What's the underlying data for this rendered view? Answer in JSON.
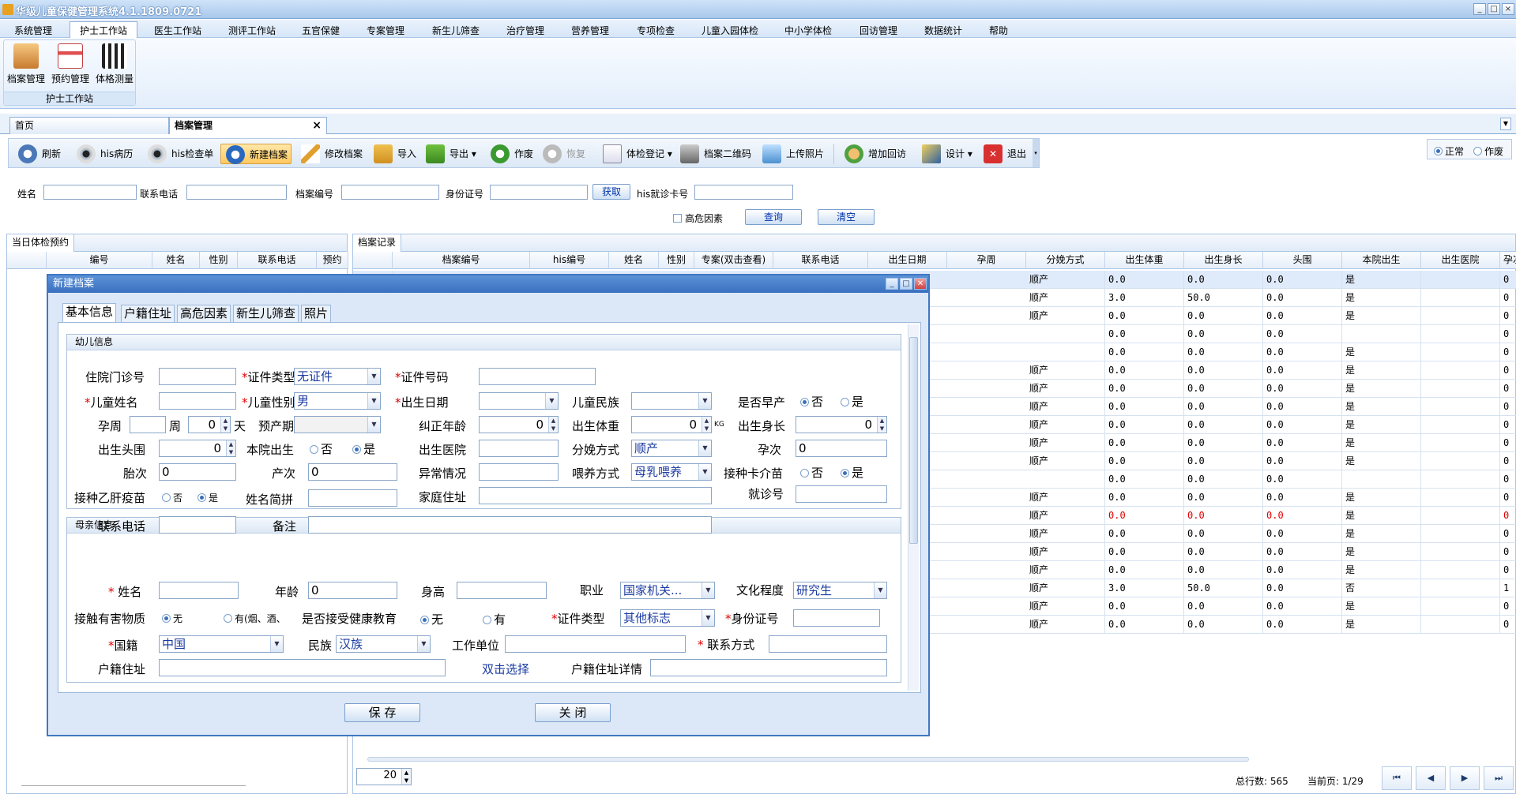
{
  "app": {
    "title": "华级儿童保健管理系统4.1.1809.0721"
  },
  "menu": [
    "系统管理",
    "护士工作站",
    "医生工作站",
    "测评工作站",
    "五官保健",
    "专案管理",
    "新生儿筛查",
    "治疗管理",
    "营养管理",
    "专项检查",
    "儿童入园体检",
    "中小学体检",
    "回访管理",
    "数据统计",
    "帮助"
  ],
  "ribbon": {
    "group_label": "护士工作站",
    "buttons": [
      "档案管理",
      "预约管理",
      "体格测量"
    ]
  },
  "page_tabs": {
    "home": "首页",
    "active": "档案管理",
    "close": "×"
  },
  "toolbar": {
    "items": [
      "刷新",
      "his病历",
      "his检查单",
      "新建档案",
      "修改档案",
      "导入",
      "导出",
      "作废",
      "恢复",
      "体检登记",
      "档案二维码",
      "上传照片",
      "增加回访",
      "设计",
      "退出"
    ],
    "status_normal": "正常",
    "status_void": "作废"
  },
  "search": {
    "name_label": "姓名",
    "phone_label": "联系电话",
    "file_no_label": "档案编号",
    "id_label": "身份证号",
    "fetch_button": "获取",
    "his_card_label": "his就诊卡号",
    "high_risk_label": "高危因素",
    "query_button": "查询",
    "clear_button": "清空"
  },
  "left_panel": {
    "title": "当日体检预约",
    "columns": [
      "编号",
      "姓名",
      "性别",
      "联系电话",
      "预约"
    ]
  },
  "right_panel": {
    "title": "档案记录",
    "columns": [
      "档案编号",
      "his编号",
      "姓名",
      "性别",
      "专案(双击查看)",
      "联系电话",
      "出生日期",
      "孕周",
      "分娩方式",
      "出生体重",
      "出生身长",
      "头围",
      "本院出生",
      "出生医院",
      "孕次"
    ],
    "rows": [
      {
        "delivery": "顺产",
        "w": "0.0",
        "l": "0.0",
        "h": "0.0",
        "local": "是",
        "g": "0"
      },
      {
        "delivery": "顺产",
        "w": "3.0",
        "l": "50.0",
        "h": "0.0",
        "local": "是",
        "g": "0"
      },
      {
        "delivery": "顺产",
        "w": "0.0",
        "l": "0.0",
        "h": "0.0",
        "local": "是",
        "g": "0"
      },
      {
        "delivery": "",
        "w": "0.0",
        "l": "0.0",
        "h": "0.0",
        "local": "",
        "g": "0"
      },
      {
        "delivery": "",
        "w": "0.0",
        "l": "0.0",
        "h": "0.0",
        "local": "是",
        "g": "0"
      },
      {
        "delivery": "顺产",
        "w": "0.0",
        "l": "0.0",
        "h": "0.0",
        "local": "是",
        "g": "0"
      },
      {
        "delivery": "顺产",
        "w": "0.0",
        "l": "0.0",
        "h": "0.0",
        "local": "是",
        "g": "0"
      },
      {
        "delivery": "顺产",
        "w": "0.0",
        "l": "0.0",
        "h": "0.0",
        "local": "是",
        "g": "0"
      },
      {
        "delivery": "顺产",
        "w": "0.0",
        "l": "0.0",
        "h": "0.0",
        "local": "是",
        "g": "0"
      },
      {
        "delivery": "顺产",
        "w": "0.0",
        "l": "0.0",
        "h": "0.0",
        "local": "是",
        "g": "0"
      },
      {
        "delivery": "顺产",
        "w": "0.0",
        "l": "0.0",
        "h": "0.0",
        "local": "是",
        "g": "0"
      },
      {
        "delivery": "",
        "w": "0.0",
        "l": "0.0",
        "h": "0.0",
        "local": "",
        "g": "0"
      },
      {
        "delivery": "顺产",
        "w": "0.0",
        "l": "0.0",
        "h": "0.0",
        "local": "是",
        "g": "0"
      },
      {
        "delivery": "顺产",
        "w": "0.0",
        "l": "0.0",
        "h": "0.0",
        "local": "是",
        "g": "0",
        "red": true
      },
      {
        "delivery": "顺产",
        "w": "0.0",
        "l": "0.0",
        "h": "0.0",
        "local": "是",
        "g": "0"
      },
      {
        "delivery": "顺产",
        "w": "0.0",
        "l": "0.0",
        "h": "0.0",
        "local": "是",
        "g": "0"
      },
      {
        "delivery": "顺产",
        "w": "0.0",
        "l": "0.0",
        "h": "0.0",
        "local": "是",
        "g": "0"
      },
      {
        "delivery": "顺产",
        "w": "3.0",
        "l": "50.0",
        "h": "0.0",
        "local": "否",
        "g": "1"
      },
      {
        "delivery": "顺产",
        "w": "0.0",
        "l": "0.0",
        "h": "0.0",
        "local": "是",
        "g": "0"
      },
      {
        "delivery": "顺产",
        "w": "0.0",
        "l": "0.0",
        "h": "0.0",
        "local": "是",
        "g": "0"
      }
    ],
    "page_size": "20",
    "total_label": "总行数: 565",
    "page_label": "当前页: 1/29",
    "nav": [
      "⏮",
      "◀",
      "▶",
      "⏭"
    ]
  },
  "dialog": {
    "title": "新建档案",
    "tabs": [
      "基本信息",
      "户籍住址",
      "高危因素",
      "新生儿筛查",
      "照片"
    ],
    "child_section": "幼儿信息",
    "mother_section": "母亲信息",
    "req": "*",
    "labels": {
      "inpatient_no": "住院门诊号",
      "id_type": "证件类型",
      "id_no": "证件号码",
      "child_name": "儿童姓名",
      "child_sex": "儿童性别",
      "birth_date": "出生日期",
      "child_nation": "儿童民族",
      "premature": "是否早产",
      "gest_week": "孕周",
      "week": "周",
      "day": "天",
      "due_date": "预产期",
      "corrected_age": "纠正年龄",
      "birth_weight": "出生体重",
      "birth_length": "出生身长",
      "head_circ": "出生头围",
      "born_here": "本院出生",
      "birth_hospital": "出生医院",
      "delivery": "分娩方式",
      "gravida": "孕次",
      "parity": "胎次",
      "para": "产次",
      "abnormal": "异常情况",
      "feeding": "喂养方式",
      "vaccine_card": "接种卡介苗",
      "hepb": "接种乙肝疫苗",
      "name_abbr": "姓名简拼",
      "home_addr": "家庭住址",
      "visit_no": "就诊号",
      "phone": "联系电话",
      "remark": "备注",
      "m_name": "姓名",
      "m_age": "年龄",
      "m_height": "身高",
      "m_job": "职业",
      "m_edu": "文化程度",
      "m_hazard": "接触有害物质",
      "m_health_edu": "是否接受健康教育",
      "m_id_type": "证件类型",
      "m_id_no": "身份证号",
      "m_nationality": "国籍",
      "m_nation": "民族",
      "m_work": "工作单位",
      "m_contact": "联系方式",
      "m_hukou": "户籍住址",
      "m_hukou_pick": "双击选择",
      "m_hukou_detail": "户籍住址详情"
    },
    "values": {
      "id_type": "无证件",
      "child_sex": "男",
      "gest_day": "0",
      "corrected_age": "0",
      "birth_weight": "0",
      "kg": "KG",
      "birth_length": "0",
      "head_circ": "0",
      "delivery": "顺产",
      "gravida": "0",
      "parity": "0",
      "para": "0",
      "feeding": "母乳喂养",
      "m_age": "0",
      "m_job": "国家机关...",
      "m_edu": "研究生",
      "m_id_type": "其他标志",
      "m_nationality": "中国",
      "m_nation": "汉族"
    },
    "options": {
      "no": "否",
      "yes": "是",
      "hazard_no": "无",
      "hazard_yes": "有(烟、酒、",
      "edu_no": "无",
      "edu_yes": "有"
    },
    "save_button": "保 存",
    "close_button": "关 闭"
  },
  "colors": {
    "accent": "#3a70c0",
    "warn": "#e00000"
  }
}
